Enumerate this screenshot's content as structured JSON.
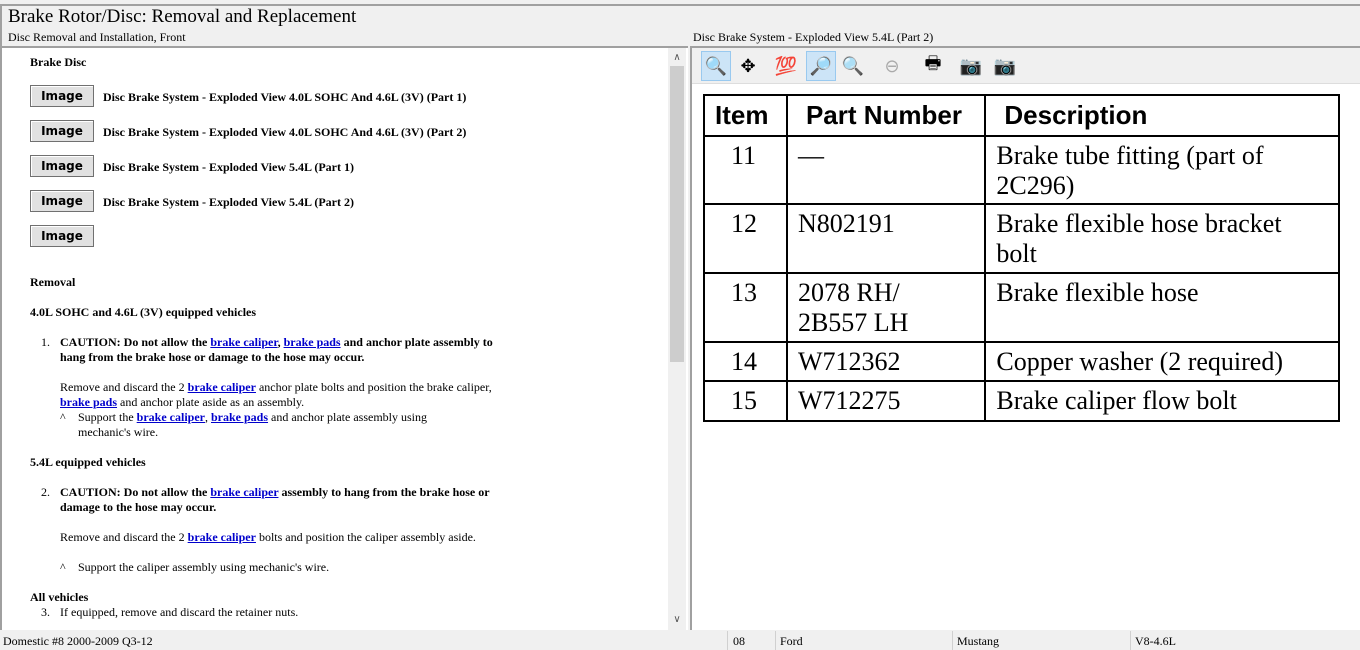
{
  "header": {
    "title": "Brake Rotor/Disc:  Removal and Replacement",
    "subtitle": "Disc Removal and Installation, Front"
  },
  "left": {
    "section": "Brake Disc",
    "images": [
      {
        "button": "Image",
        "label": "Disc Brake System - Exploded View 4.0L SOHC And 4.6L (3V) (Part 1)"
      },
      {
        "button": "Image",
        "label": "Disc Brake System - Exploded View 4.0L SOHC And 4.6L (3V) (Part 2)"
      },
      {
        "button": "Image",
        "label": "Disc Brake System - Exploded View 5.4L (Part 1)"
      },
      {
        "button": "Image",
        "label": "Disc Brake System - Exploded View 5.4L (Part 2)"
      },
      {
        "button": "Image",
        "label": ""
      }
    ],
    "removal": "Removal",
    "group1": "4.0L SOHC and 4.6L (3V) equipped vehicles",
    "group2": "5.4L equipped vehicles",
    "group3": "All vehicles",
    "paras": [
      {
        "num": "1.",
        "segs": [
          {
            "t": "CAUTION: Do not allow the ",
            "s": "b"
          },
          {
            "t": "brake caliper",
            "s": "a"
          },
          {
            "t": ", ",
            "s": "b"
          },
          {
            "t": "brake pads",
            "s": "a"
          },
          {
            "t": " and anchor plate assembly to hang from the brake hose or damage to the hose may occur.",
            "s": "b"
          }
        ]
      },
      {
        "num": "",
        "segs": [
          {
            "t": "Remove and discard the 2 "
          },
          {
            "t": "brake caliper",
            "s": "a"
          },
          {
            "t": " anchor plate bolts and position the brake caliper, "
          },
          {
            "t": "brake pads",
            "s": "a"
          },
          {
            "t": " and anchor plate aside as an assembly."
          }
        ]
      },
      {
        "num": "^",
        "segs": [
          {
            "t": "Support the "
          },
          {
            "t": "brake caliper",
            "s": "a"
          },
          {
            "t": ", "
          },
          {
            "t": "brake pads",
            "s": "a"
          },
          {
            "t": " and anchor plate assembly using mechanic's wire."
          }
        ]
      },
      {
        "num": "2.",
        "segs": [
          {
            "t": "CAUTION: Do not allow the ",
            "s": "b"
          },
          {
            "t": "brake caliper",
            "s": "a"
          },
          {
            "t": " assembly to hang from the brake hose or damage to the hose may occur.",
            "s": "b"
          }
        ]
      },
      {
        "num": "",
        "segs": [
          {
            "t": "Remove and discard the 2 "
          },
          {
            "t": "brake caliper",
            "s": "a"
          },
          {
            "t": " bolts and position the caliper assembly aside."
          }
        ]
      },
      {
        "num": "^",
        "segs": [
          {
            "t": "Support the caliper assembly using mechanic's wire."
          }
        ]
      },
      {
        "num": "3.",
        "segs": [
          {
            "t": "If equipped, remove and discard the retainer nuts."
          }
        ]
      }
    ]
  },
  "right": {
    "title": "Disc Brake System - Exploded View 5.4L (Part 2)",
    "toolbar": [
      {
        "icon": "zoom-in-icon",
        "glyph": "🔍",
        "active": true
      },
      {
        "icon": "pan-icon",
        "glyph": "✥",
        "active": false
      },
      {
        "icon": "zoom-100-icon",
        "glyph": "💯",
        "active": false
      },
      {
        "icon": "zoom-fit-icon",
        "glyph": "🔎",
        "active": true
      },
      {
        "icon": "zoom-width-icon",
        "glyph": "🔍",
        "active": false
      },
      {
        "icon": "zoom-out-icon",
        "glyph": "⊖",
        "active": false
      },
      {
        "icon": "print-icon",
        "glyph": "🖶",
        "active": false
      },
      {
        "icon": "previous-image-icon",
        "glyph": "📷",
        "active": false
      },
      {
        "icon": "next-image-icon",
        "glyph": "📷",
        "active": false
      }
    ],
    "table": {
      "headers": [
        "Item",
        "Part Number",
        "Description"
      ],
      "rows": [
        [
          "11",
          "—",
          "Brake tube fitting (part of 2C296)"
        ],
        [
          "12",
          "N802191",
          "Brake flexible hose bracket bolt"
        ],
        [
          "13",
          "2078 RH/ 2B557 LH",
          "Brake flexible hose"
        ],
        [
          "14",
          "W712362",
          "Copper washer (2 required)"
        ],
        [
          "15",
          "W712275",
          "Brake caliper flow bolt"
        ]
      ]
    }
  },
  "status": [
    "Domestic #8 2000-2009 Q3-12",
    "08",
    "Ford",
    "Mustang",
    "V8-4.6L"
  ]
}
